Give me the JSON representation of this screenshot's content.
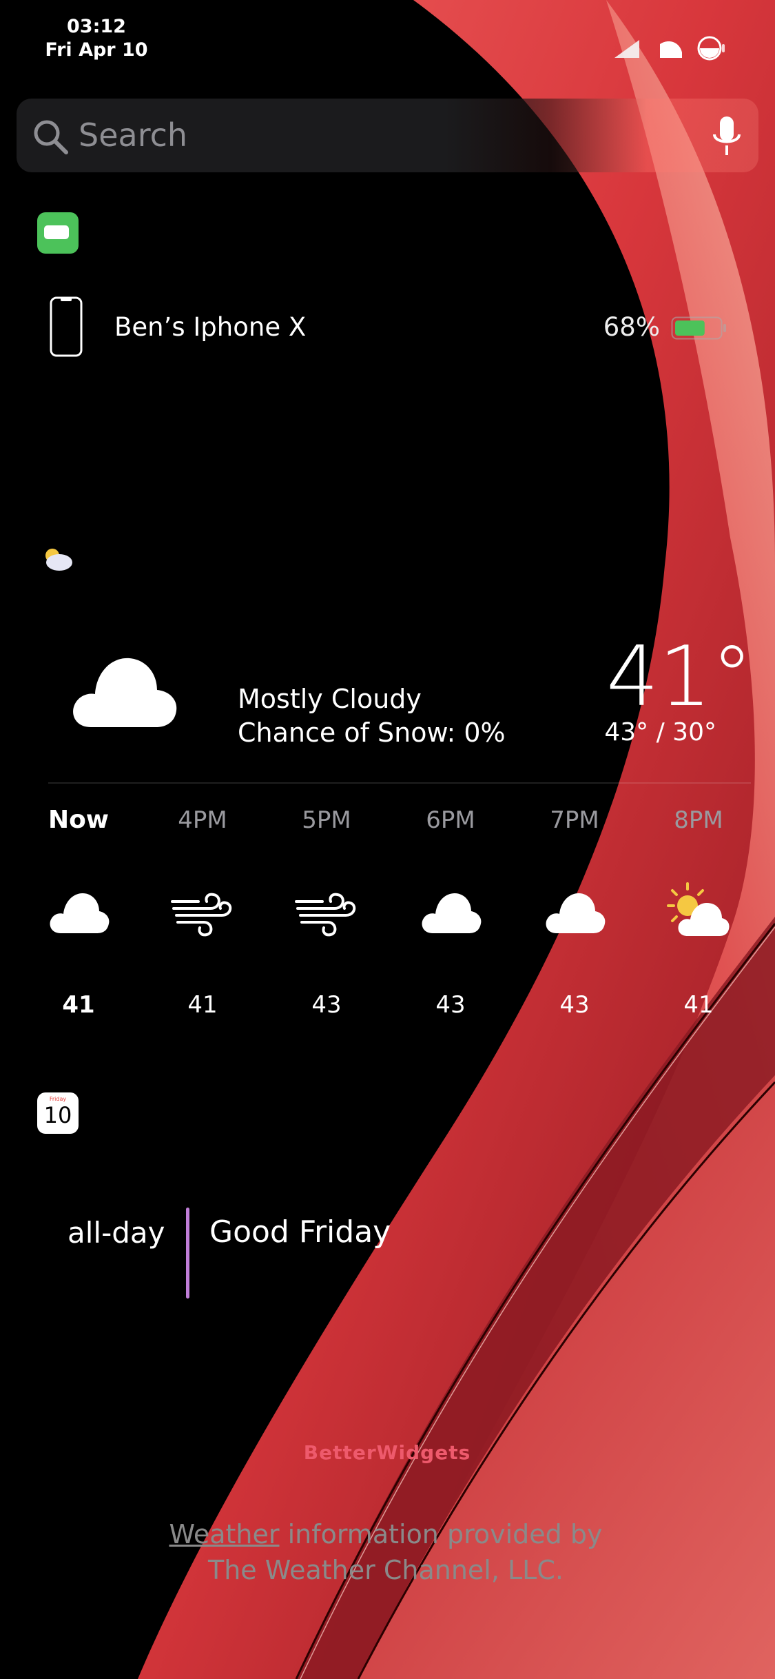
{
  "status_bar": {
    "time": "03:12",
    "date": "Fri Apr 10"
  },
  "search": {
    "placeholder": "Search"
  },
  "battery_widget": {
    "device_name": "Ben’s Iphone X",
    "percent": "68%",
    "level": 0.68,
    "color": "#4cc25a"
  },
  "weather_widget": {
    "condition": "Mostly Cloudy",
    "snow_chance": "Chance of Snow: 0%",
    "temperature": "41°",
    "range": "43° / 30°",
    "hourly": [
      {
        "label": "Now",
        "icon": "cloud-icon",
        "temp": "41"
      },
      {
        "label": "4PM",
        "icon": "wind-icon",
        "temp": "41"
      },
      {
        "label": "5PM",
        "icon": "wind-icon",
        "temp": "43"
      },
      {
        "label": "6PM",
        "icon": "cloud-icon",
        "temp": "43"
      },
      {
        "label": "7PM",
        "icon": "cloud-icon",
        "temp": "43"
      },
      {
        "label": "8PM",
        "icon": "partly-sunny-icon",
        "temp": "41"
      }
    ]
  },
  "calendar_widget": {
    "icon_day": "Friday",
    "icon_date": "10",
    "event_time": "all-day",
    "event_title": "Good Friday",
    "event_color": "#c07ed8"
  },
  "footer": {
    "brand": "BetterWidgets",
    "credit_link": "Weather",
    "credit_line1_rest": " information provided by",
    "credit_line2": "The Weather Channel, LLC."
  },
  "colors": {
    "accent_red": "#e14b4f",
    "background": "#000000"
  }
}
